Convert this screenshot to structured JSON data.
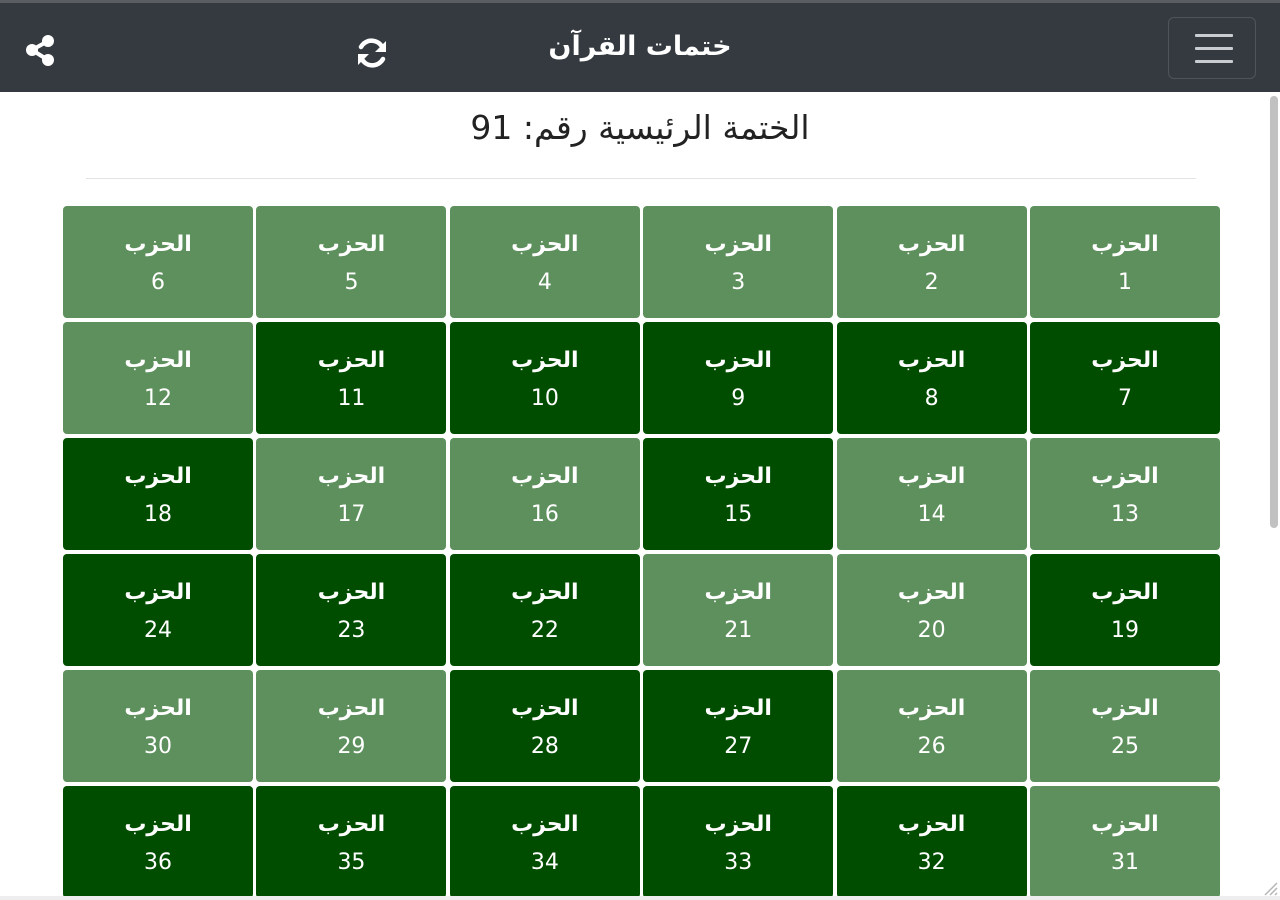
{
  "navbar": {
    "title": "ختمات القرآن",
    "menu_icon": "hamburger-menu-icon",
    "refresh_icon": "refresh-icon",
    "share_icon": "share-icon",
    "background": "#343a40"
  },
  "heading": "الختمة الرئيسية رقم: 91",
  "colors": {
    "completed": "#004d00",
    "not_completed": "#5e905d"
  },
  "hizb_label": "الحزب",
  "hizbs": [
    {
      "number": "1",
      "completed": false
    },
    {
      "number": "2",
      "completed": false
    },
    {
      "number": "3",
      "completed": false
    },
    {
      "number": "4",
      "completed": false
    },
    {
      "number": "5",
      "completed": false
    },
    {
      "number": "6",
      "completed": false
    },
    {
      "number": "7",
      "completed": true
    },
    {
      "number": "8",
      "completed": true
    },
    {
      "number": "9",
      "completed": true
    },
    {
      "number": "10",
      "completed": true
    },
    {
      "number": "11",
      "completed": true
    },
    {
      "number": "12",
      "completed": false
    },
    {
      "number": "13",
      "completed": false
    },
    {
      "number": "14",
      "completed": false
    },
    {
      "number": "15",
      "completed": true
    },
    {
      "number": "16",
      "completed": false
    },
    {
      "number": "17",
      "completed": false
    },
    {
      "number": "18",
      "completed": true
    },
    {
      "number": "19",
      "completed": true
    },
    {
      "number": "20",
      "completed": false
    },
    {
      "number": "21",
      "completed": false
    },
    {
      "number": "22",
      "completed": true
    },
    {
      "number": "23",
      "completed": true
    },
    {
      "number": "24",
      "completed": true
    },
    {
      "number": "25",
      "completed": false
    },
    {
      "number": "26",
      "completed": false
    },
    {
      "number": "27",
      "completed": true
    },
    {
      "number": "28",
      "completed": true
    },
    {
      "number": "29",
      "completed": false
    },
    {
      "number": "30",
      "completed": false
    },
    {
      "number": "31",
      "completed": false
    },
    {
      "number": "32",
      "completed": true
    },
    {
      "number": "33",
      "completed": true
    },
    {
      "number": "34",
      "completed": true
    },
    {
      "number": "35",
      "completed": true
    },
    {
      "number": "36",
      "completed": true
    }
  ]
}
